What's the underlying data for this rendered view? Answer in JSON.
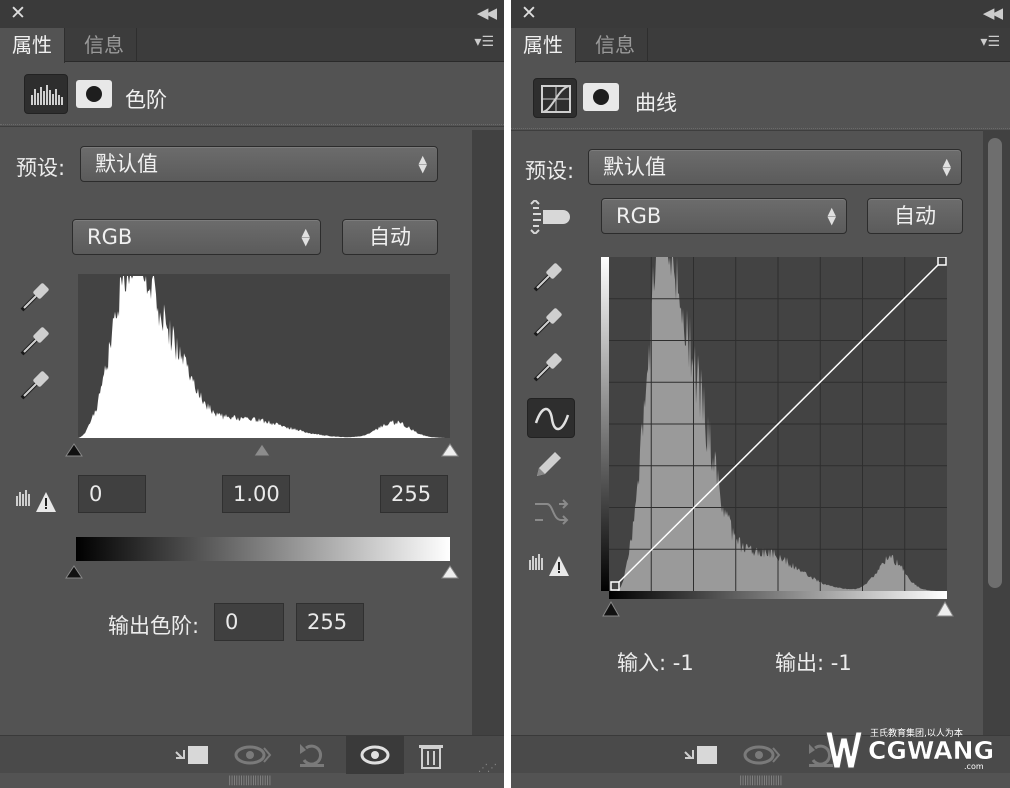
{
  "left_panel": {
    "tabs": [
      {
        "label": "属性"
      },
      {
        "label": "信息"
      }
    ],
    "title": "色阶",
    "preset_label": "预设:",
    "preset_value": "默认值",
    "channel_value": "RGB",
    "auto_label": "自动",
    "input_black": "0",
    "input_gamma": "1.00",
    "input_white": "255",
    "output_label": "输出色阶:",
    "output_black": "0",
    "output_white": "255"
  },
  "right_panel": {
    "tabs": [
      {
        "label": "属性"
      },
      {
        "label": "信息"
      }
    ],
    "title": "曲线",
    "preset_label": "预设:",
    "preset_value": "默认值",
    "channel_value": "RGB",
    "auto_label": "自动",
    "input_readout": "输入: -1",
    "output_readout": "输出: -1"
  },
  "watermark": {
    "brand": "CGWANG",
    "slogan": "王氏教育集团,以人为本",
    "domain": ".com"
  },
  "icons": [
    "close-icon",
    "collapse-icon",
    "panel-menu-icon",
    "levels-icon",
    "curves-icon",
    "mask-icon",
    "eyedropper-icon",
    "curve-point-icon",
    "pencil-icon",
    "smooth-icon",
    "clip-warning-icon",
    "hand-adjust-icon",
    "clip-to-layer-icon",
    "view-previous-icon",
    "reset-icon",
    "visibility-icon",
    "trash-icon"
  ],
  "colors": {
    "panel_bg": "#535353",
    "dark_bg": "#3a3a3a",
    "histogram_white": "#ffffff",
    "histogram_gray": "#9a9a9a"
  }
}
